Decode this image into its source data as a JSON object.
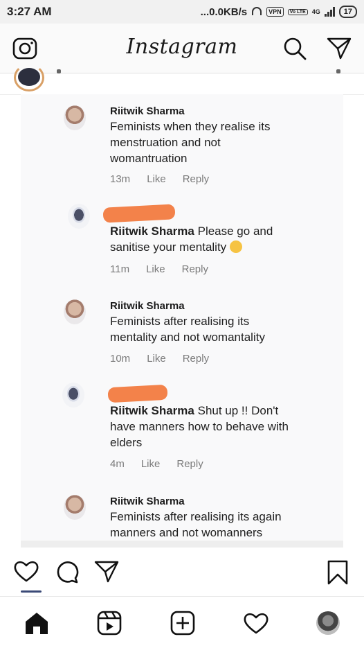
{
  "status_bar": {
    "time": "3:27 AM",
    "network_speed": "...0.0KB/s",
    "vpn_label": "VPN",
    "volte_label": "Vo LTE",
    "network_type": "4G",
    "battery": "17"
  },
  "header": {
    "app_name": "Instagram"
  },
  "comments": [
    {
      "author": "Riitwik Sharma",
      "text": "Feminists when they realise its menstruation and not womantruation",
      "time": "13m",
      "like_label": "Like",
      "reply_label": "Reply"
    },
    {
      "mention": "Riitwik Sharma",
      "text": "Please go and sanitise your mentality",
      "time": "11m",
      "like_label": "Like",
      "reply_label": "Reply"
    },
    {
      "author": "Riitwik Sharma",
      "text": "Feminists after realising its mentality and not womantality",
      "time": "10m",
      "like_label": "Like",
      "reply_label": "Reply"
    },
    {
      "mention": "Riitwik Sharma",
      "text": "Shut up !! Don't have manners how to behave with elders",
      "time": "4m",
      "like_label": "Like",
      "reply_label": "Reply"
    },
    {
      "author": "Riitwik Sharma",
      "text": "Feminists after realising its again manners and not womanners"
    }
  ],
  "colors": {
    "redaction": "#f3824a",
    "meta_text": "#7b7b7b",
    "story_ring": "#d9a066"
  },
  "icons": {
    "header": [
      "camera-icon",
      "search-icon",
      "direct-message-icon"
    ],
    "actions": [
      "heart-icon",
      "comment-icon",
      "share-icon",
      "bookmark-icon"
    ],
    "nav": [
      "home-icon",
      "reels-icon",
      "new-post-icon",
      "activity-icon",
      "profile-avatar"
    ]
  }
}
